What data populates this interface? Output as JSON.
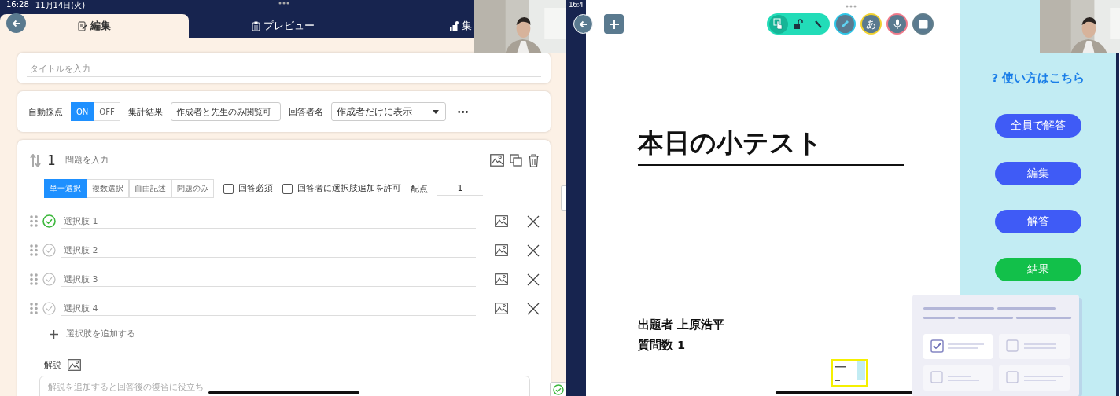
{
  "left": {
    "status_time": "16:28",
    "status_date": "11月14日(火)",
    "tabs": [
      {
        "label": "編集",
        "kind": "edit",
        "selected": true
      },
      {
        "label": "プレビュー",
        "kind": "preview",
        "selected": false
      },
      {
        "label": "集",
        "kind": "stats",
        "selected": false
      }
    ],
    "title_field": {
      "placeholder": "タイトルを入力"
    },
    "settings": {
      "auto_label": "自動採点",
      "auto_toggle": [
        {
          "label": "ON",
          "selected": true
        },
        {
          "label": "OFF",
          "selected": false
        }
      ],
      "results_label": "集計結果",
      "results_value": "作成者と先生のみ閲覧可",
      "name_label": "回答者名",
      "name_value": "作成者だけに表示",
      "more": "•••"
    },
    "question": {
      "number": "1",
      "placeholder": "問題を入力",
      "types": [
        {
          "label": "単一選択",
          "selected": true
        },
        {
          "label": "複数選択",
          "selected": false
        },
        {
          "label": "自由記述",
          "selected": false
        },
        {
          "label": "問題のみ",
          "selected": false
        }
      ],
      "options": [
        {
          "label": "回答必須",
          "checked": false
        },
        {
          "label": "回答者に選択肢追加を許可",
          "checked": false
        }
      ],
      "points_label": "配点",
      "points_value": "1",
      "choices": [
        {
          "placeholder": "選択肢 1",
          "correct": true
        },
        {
          "placeholder": "選択肢 2",
          "correct": false
        },
        {
          "placeholder": "選択肢 3",
          "correct": false
        },
        {
          "placeholder": "選択肢 4",
          "correct": false
        }
      ],
      "add_choice": "選択肢を追加する",
      "explanation_label": "解説",
      "explanation_placeholder": "解説を追加すると回答後の復習に役立ち"
    }
  },
  "right": {
    "status_time": "16:4",
    "modes": [
      {
        "kind": "touch",
        "selected": true
      },
      {
        "kind": "lock",
        "selected": false
      },
      {
        "kind": "pen",
        "selected": false
      }
    ],
    "tools": [
      {
        "kind": "pen",
        "color": "#2ec5e6"
      },
      {
        "kind": "text",
        "label": "あ",
        "color": "#f2d22e"
      },
      {
        "kind": "mic",
        "color": "#f07a8a"
      },
      {
        "kind": "stop",
        "color": "#607d8b"
      }
    ],
    "slide": {
      "title": "本日の小テスト",
      "author": "出題者 上原浩平",
      "question_count": "質問数 1"
    },
    "help_link": "? 使い方はこちら",
    "buttons": [
      {
        "label": "全員で解答",
        "color": "#3f5bf6"
      },
      {
        "label": "編集",
        "color": "#3f5bf6"
      },
      {
        "label": "解答",
        "color": "#3f5bf6"
      },
      {
        "label": "結果",
        "color": "#12c04a"
      }
    ]
  }
}
